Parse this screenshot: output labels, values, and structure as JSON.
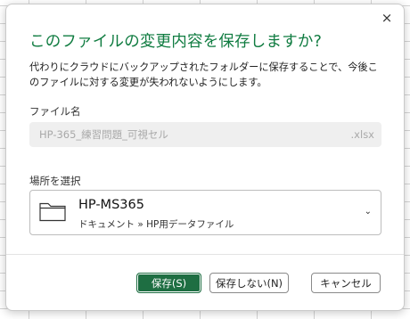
{
  "dialog": {
    "title": "このファイルの変更内容を保存しますか?",
    "description": "代わりにクラウドにバックアップされたフォルダーに保存することで、今後このファイルに対する変更が失われないようにします。",
    "close_icon": "×"
  },
  "filename": {
    "label": "ファイル名",
    "value": "HP-365_練習問題_可視セル",
    "extension": ".xlsx"
  },
  "location": {
    "label": "場所を選択",
    "name": "HP-MS365",
    "path": "ドキュメント » HP用データファイル",
    "icon": "folder-icon",
    "chevron": "⌄"
  },
  "buttons": {
    "save_label": "保存(S)",
    "dont_save_label": "保存しない(N)",
    "cancel_label": "キャンセル"
  },
  "colors": {
    "accent": "#107c41",
    "primary_button": "#1e6e42"
  }
}
